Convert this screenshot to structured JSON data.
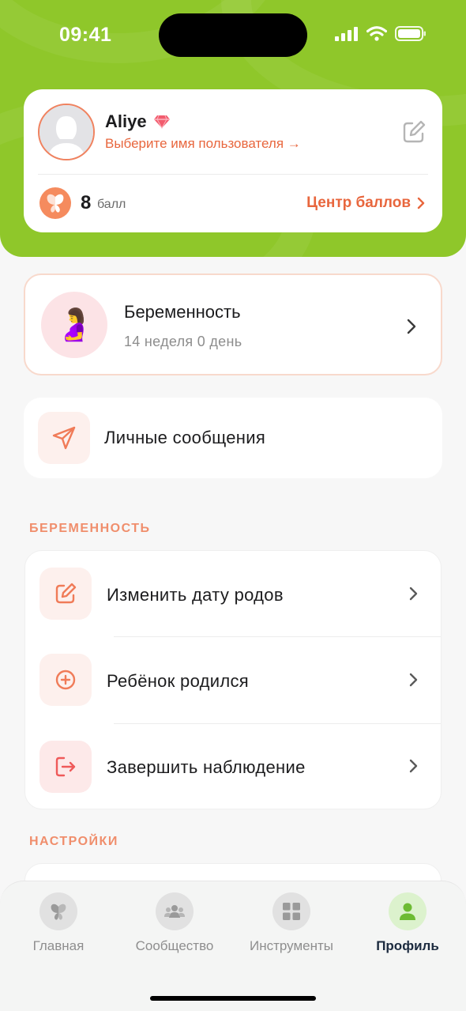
{
  "status_bar": {
    "time": "09:41"
  },
  "profile": {
    "username": "Aliye",
    "choose_name_link": "Выберите имя пользователя →",
    "points_value": "8",
    "points_unit": "балл",
    "points_center_label": "Центр баллов"
  },
  "pregnancy_card": {
    "title": "Беременность",
    "subtitle": "14 неделя 0 день",
    "emoji": "🤰"
  },
  "messages": {
    "label": "Личные сообщения"
  },
  "sections": {
    "pregnancy": {
      "title": "БЕРЕМЕННОСТЬ",
      "items": [
        {
          "label": "Изменить дату родов",
          "icon": "edit-icon"
        },
        {
          "label": "Ребёнок родился",
          "icon": "plus-circle-icon"
        },
        {
          "label": "Завершить наблюдение",
          "icon": "exit-icon"
        }
      ]
    },
    "settings": {
      "title": "НАСТРОЙКИ"
    }
  },
  "tabbar": {
    "tabs": [
      {
        "label": "Главная",
        "icon": "butterfly-icon",
        "active": false
      },
      {
        "label": "Сообщество",
        "icon": "community-icon",
        "active": false
      },
      {
        "label": "Инструменты",
        "icon": "grid-icon",
        "active": false
      },
      {
        "label": "Профиль",
        "icon": "person-icon",
        "active": true
      }
    ]
  },
  "colors": {
    "header_green": "#8fc72a",
    "accent_orange": "#e8663d",
    "active_tab_green": "#7bc142"
  }
}
